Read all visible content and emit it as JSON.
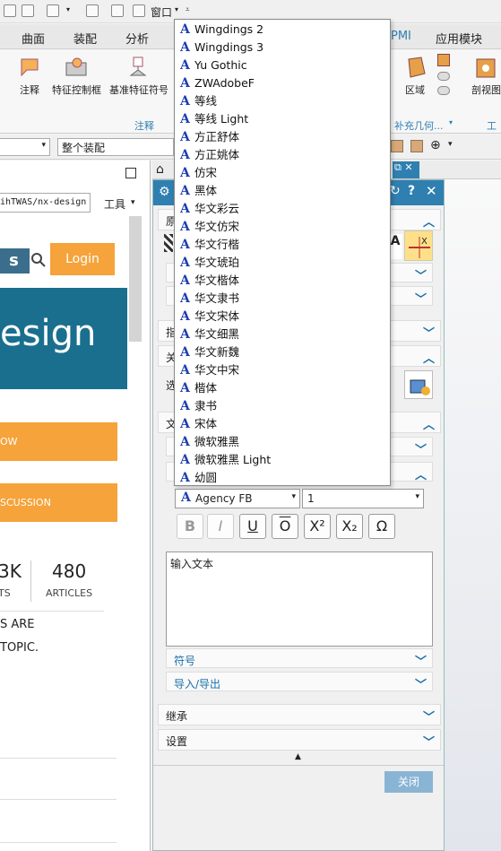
{
  "quick_access": {
    "window_menu": "窗口"
  },
  "menu_tabs": [
    "曲面",
    "装配",
    "分析",
    "PMI",
    "应用模块"
  ],
  "ribbon": {
    "left_buttons": [
      "注释",
      "特征控制框",
      "基准特征符号"
    ],
    "left_group": "注释",
    "right_buttons": [
      "区域",
      "剖视图"
    ],
    "right_group_supplement": "补充几何...",
    "right_group_work": "工"
  },
  "selection": {
    "filter_value": "",
    "assembly_value": "整个装配"
  },
  "browser": {
    "url": "ihTWAS/nx-design",
    "tools": "工具",
    "search_icon": "search-icon",
    "login_button": "Login",
    "s_badge": "s",
    "hero_text": "esign",
    "orange_btn_1": "OW",
    "orange_btn_2": "SCUSSION",
    "stat1_value": "3K",
    "stat1_label": "TS",
    "stat2_value": "480",
    "stat2_label": "ARTICLES",
    "para_line1": "S ARE",
    "para_line2": "TOPIC."
  },
  "dialog": {
    "sections": {
      "origin": "原",
      "indicator": "指",
      "assoc": "关",
      "select": "选",
      "text": "文",
      "symbol": "符号",
      "import_export": "导入/导出",
      "inherit": "继承",
      "settings": "设置"
    },
    "font_select": {
      "value": "Agency FB"
    },
    "size_select": {
      "value": "1"
    },
    "format_buttons": [
      "B",
      "I",
      "U",
      "O",
      "X²",
      "X₂",
      "Ω"
    ],
    "text_area": "输入文本",
    "close_button": "关闭"
  },
  "font_dropdown": {
    "items": [
      "Wingdings 2",
      "Wingdings 3",
      "Yu Gothic",
      "ZWAdobeF",
      "等线",
      "等线 Light",
      "方正舒体",
      "方正姚体",
      "仿宋",
      "黑体",
      "华文彩云",
      "华文仿宋",
      "华文行楷",
      "华文琥珀",
      "华文楷体",
      "华文隶书",
      "华文宋体",
      "华文细黑",
      "华文新魏",
      "华文中宋",
      "楷体",
      "隶书",
      "宋体",
      "微软雅黑",
      "微软雅黑 Light",
      "幼圆"
    ]
  },
  "colors": {
    "accent": "#2f7fb0",
    "orange": "#f5a33a",
    "teal": "#1a6f8f"
  }
}
